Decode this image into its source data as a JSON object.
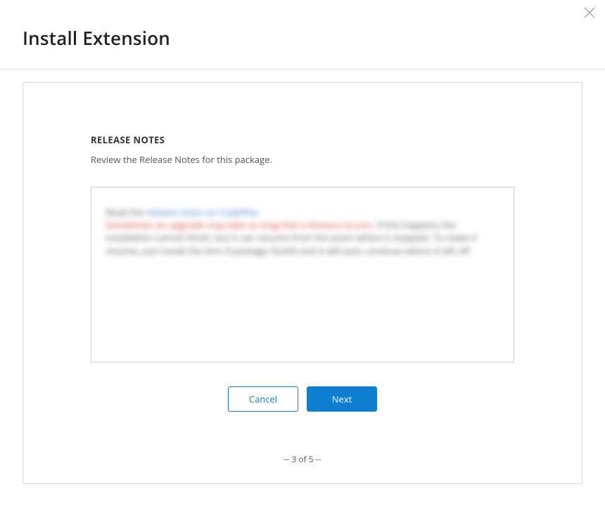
{
  "header": {
    "title": "Install Extension"
  },
  "section": {
    "heading": "RELEASE NOTES",
    "subtext": "Review the Release Notes for this package."
  },
  "buttons": {
    "cancel": "Cancel",
    "next": "Next"
  },
  "pager": {
    "text": "-- 3 of 5 --",
    "current": 3,
    "total": 5
  }
}
